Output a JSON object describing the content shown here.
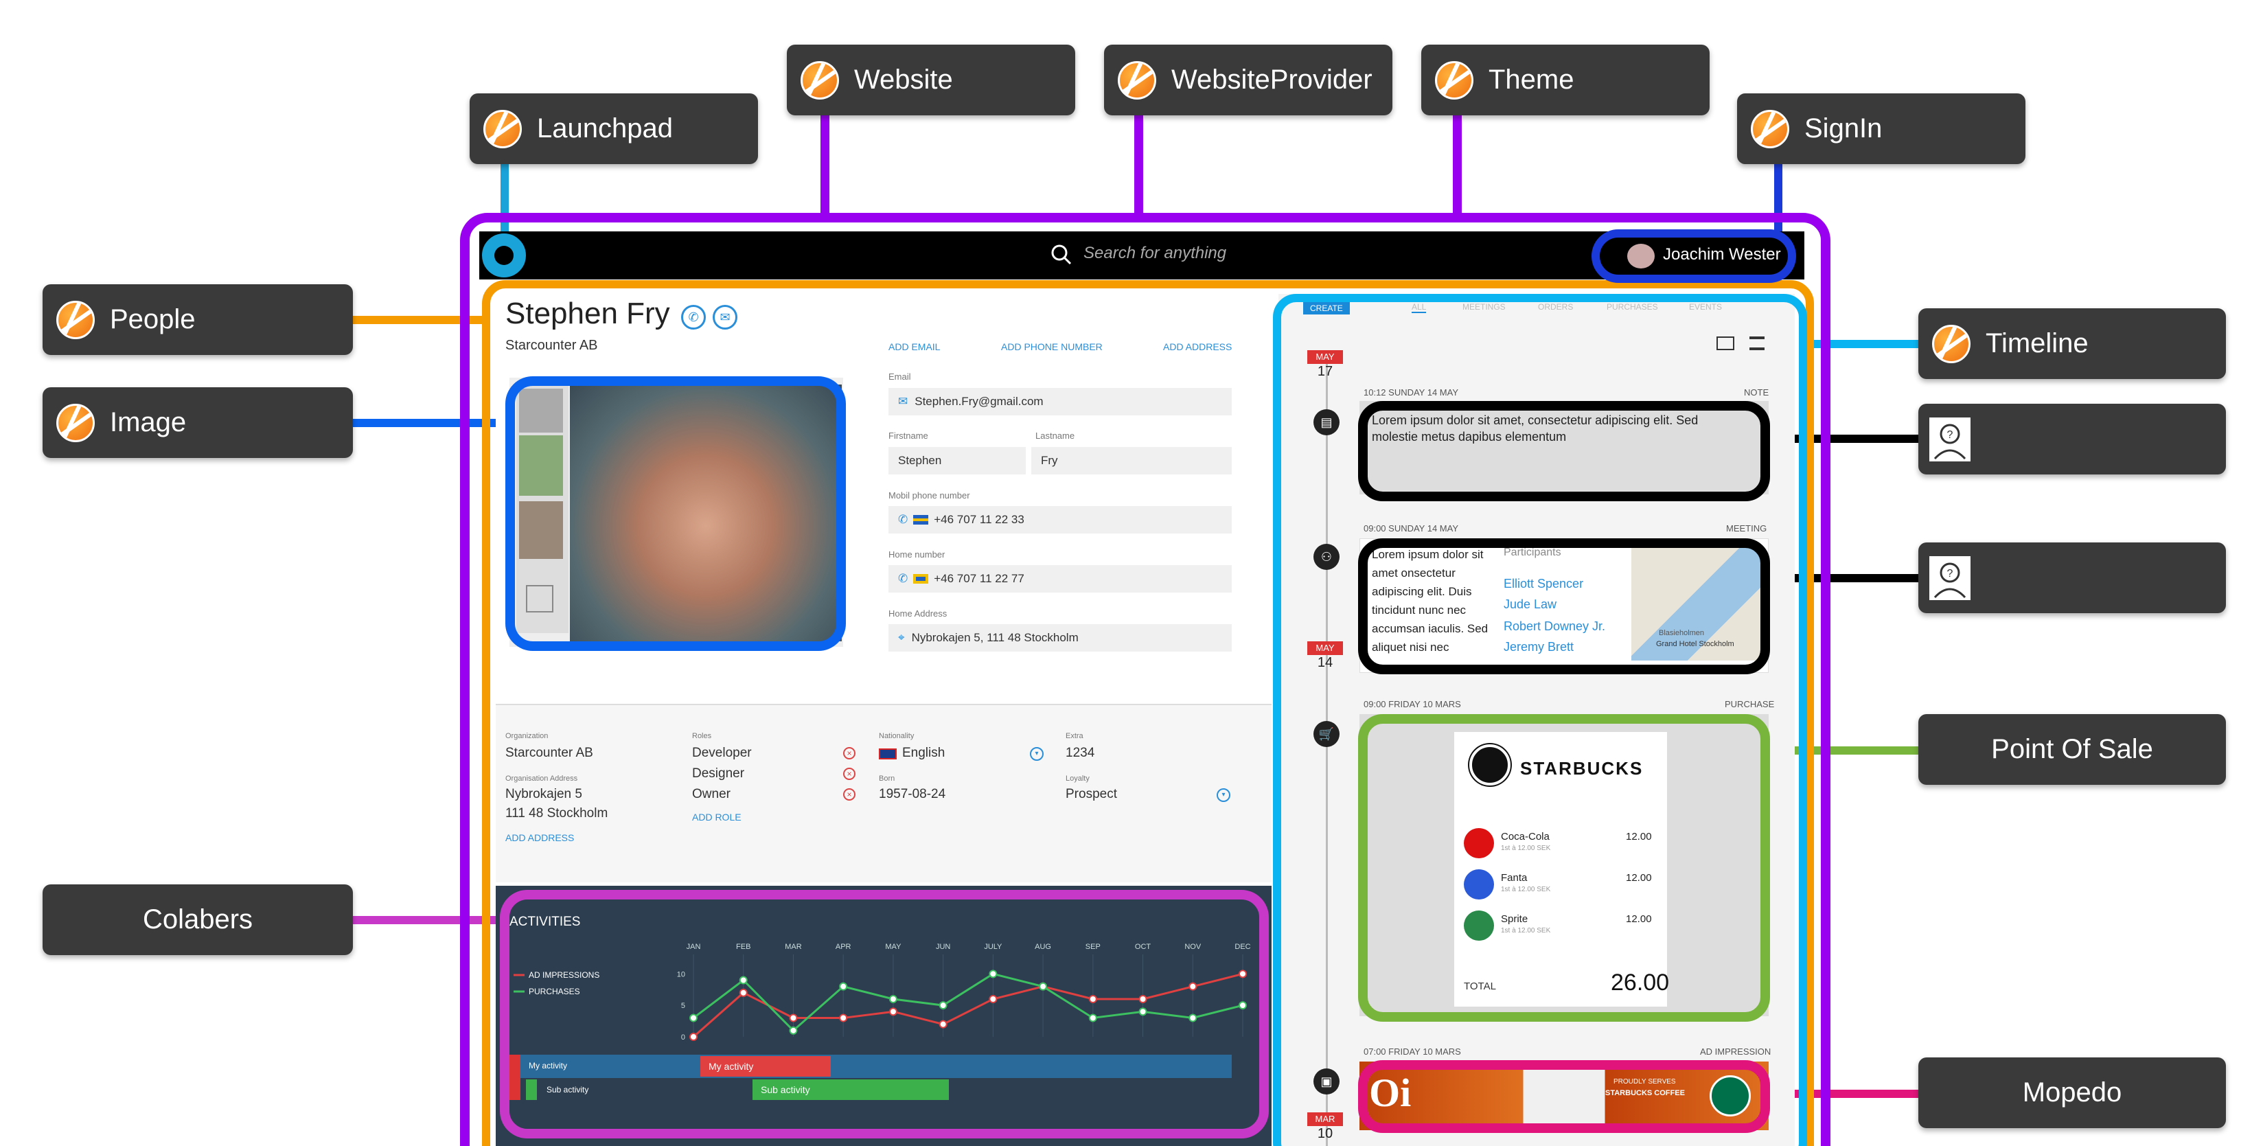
{
  "labels": {
    "launchpad": "Launchpad",
    "website": "Website",
    "website_provider": "WebsiteProvider",
    "theme": "Theme",
    "signin": "SignIn",
    "people": "People",
    "image": "Image",
    "colabers": "Colabers",
    "timeline": "Timeline",
    "point_of_sale": "Point Of Sale",
    "mopedo": "Mopedo"
  },
  "colors": {
    "website": "#9a00f0",
    "launchpad": "#1aa3d9",
    "signin": "#1a3ad9",
    "people": "#f59b00",
    "image": "#0a64f0",
    "timeline": "#0ab4f0",
    "colabers": "#c838c8",
    "pos": "#78b53c",
    "mopedo": "#e0147a",
    "unknown": "#000000"
  },
  "topbar": {
    "search_placeholder": "Search for anything",
    "user_name": "Joachim Wester",
    "menu_icon": "grid-icon",
    "search_icon": "search-icon"
  },
  "profile": {
    "name": "Stephen Fry",
    "company": "Starcounter AB",
    "add_email": "ADD EMAIL",
    "add_phone": "ADD PHONE NUMBER",
    "add_address": "ADD ADDRESS",
    "email_label": "Email",
    "email": "Stephen.Fry@gmail.com",
    "firstname_label": "Firstname",
    "firstname": "Stephen",
    "lastname_label": "Lastname",
    "lastname": "Fry",
    "mobile_label": "Mobil phone number",
    "mobile": "+46 707 11 22 33",
    "home_label": "Home number",
    "home": "+46 707 11 22 77",
    "address_label": "Home Address",
    "address": "Nybrokajen 5, 111 48 Stockholm"
  },
  "org": {
    "org_label": "Organization",
    "org": "Starcounter AB",
    "org_address_label": "Organisation Address",
    "org_address_1": "Nybrokajen 5",
    "org_address_2": "111 48 Stockholm",
    "add_address": "ADD ADDRESS",
    "roles_label": "Roles",
    "roles": [
      "Developer",
      "Designer",
      "Owner"
    ],
    "add_role": "ADD ROLE",
    "nationality_label": "Nationality",
    "nationality": "English",
    "born_label": "Born",
    "born": "1957-08-24",
    "extra_label": "Extra",
    "extra": "1234",
    "loyalty_label": "Loyalty",
    "loyalty": "Prospect"
  },
  "activities": {
    "title": "ACTIVITIES",
    "row1": "My activity",
    "row1_bar": "My activity",
    "row2": "Sub activity",
    "row2_bar": "Sub activity"
  },
  "chart_data": {
    "type": "line",
    "categories": [
      "JAN",
      "FEB",
      "MAR",
      "APR",
      "MAY",
      "JUN",
      "JULY",
      "AUG",
      "SEP",
      "OCT",
      "NOV",
      "DEC"
    ],
    "series": [
      {
        "name": "AD IMPRESSIONS",
        "color": "#e04040",
        "values": [
          0,
          7,
          3,
          3,
          4,
          2,
          6,
          8,
          6,
          6,
          8,
          10
        ]
      },
      {
        "name": "PURCHASES",
        "color": "#3cc060",
        "values": [
          3,
          9,
          1,
          8,
          6,
          5,
          10,
          8,
          3,
          4,
          3,
          5
        ]
      }
    ],
    "yticks": [
      0,
      5,
      10
    ],
    "ylim": [
      0,
      12
    ]
  },
  "timeline": {
    "tabs": [
      "CREATE",
      "ALL",
      "MEETINGS",
      "ORDERS",
      "PURCHASES",
      "EVENTS"
    ],
    "entries": [
      {
        "meta": "10:12 SUNDAY 14 MAY",
        "type": "NOTE",
        "text": "Lorem ipsum dolor sit amet, consectetur adipiscing elit. Sed molestie metus dapibus elementum"
      },
      {
        "meta": "09:00 SUNDAY 14 MAY",
        "type": "MEETING",
        "text": "Lorem ipsum dolor sit amet onsectetur adipiscing elit. Duis tincidunt nunc nec accumsan iaculis. Sed aliquet nisi nec",
        "participants_label": "Participants",
        "participants": [
          "Elliott Spencer",
          "Jude Law",
          "Robert Downey Jr.",
          "Jeremy Brett"
        ],
        "map_label": "Grand Hotel Stockholm",
        "map_area": "Blasieholmen"
      },
      {
        "meta": "09:00 FRIDAY 10 MARS",
        "type": "PURCHASE"
      },
      {
        "meta": "07:00 FRIDAY 10 MARS",
        "type": "AD IMPRESSION"
      }
    ],
    "dates": [
      {
        "month": "MAY",
        "day": "17"
      },
      {
        "month": "MAY",
        "day": "14"
      },
      {
        "month": "MAR",
        "day": "10"
      }
    ]
  },
  "receipt": {
    "brand": "STARBUCKS",
    "items": [
      {
        "name": "Coca-Cola",
        "sub": "1st à 12.00 SEK",
        "price": "12.00"
      },
      {
        "name": "Fanta",
        "sub": "1st à 12.00 SEK",
        "price": "12.00"
      },
      {
        "name": "Sprite",
        "sub": "1st à 12.00 SEK",
        "price": "12.00"
      }
    ],
    "total_label": "TOTAL",
    "total": "26.00"
  },
  "ad": {
    "logo": "Oi",
    "proud": "PROUDLY SERVES",
    "brand": "STARBUCKS COFFEE"
  }
}
